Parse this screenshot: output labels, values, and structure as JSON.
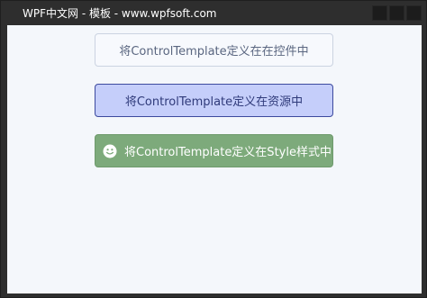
{
  "window": {
    "title": "WPF中文网 - 模板 - www.wpfsoft.com"
  },
  "buttons": {
    "control_template": "将ControlTemplate定义在在控件中",
    "resource_template": "将ControlTemplate定义在资源中",
    "style_template": "将ControlTemplate定义在Style样式中",
    "style_template_icon": "smiley-icon"
  },
  "colors": {
    "titlebar": "#2e2e2e",
    "client_bg": "#f4f7fb",
    "resource_button_bg": "#c5cefa",
    "resource_button_border": "#3c4a9e",
    "style_button_bg": "#7daa7b"
  }
}
